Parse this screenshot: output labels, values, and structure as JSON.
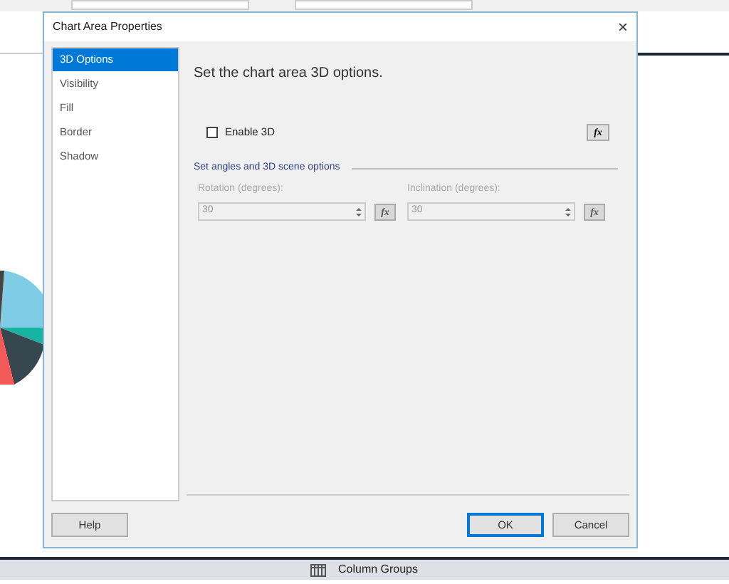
{
  "background": {
    "bottom_bar": {
      "label": "Column Groups"
    }
  },
  "dialog": {
    "title": "Chart Area Properties",
    "close": "×",
    "nav": [
      {
        "label": "3D Options",
        "selected": true
      },
      {
        "label": "Visibility",
        "selected": false
      },
      {
        "label": "Fill",
        "selected": false
      },
      {
        "label": "Border",
        "selected": false
      },
      {
        "label": "Shadow",
        "selected": false
      }
    ],
    "heading": "Set the chart area 3D options.",
    "enable_3d": {
      "label": "Enable 3D",
      "checked": false,
      "expression": "fx"
    },
    "section": "Set angles and 3D scene options",
    "fields": [
      {
        "label": "Rotation (degrees):",
        "value": "30",
        "disabled": true,
        "expression": "fx"
      },
      {
        "label": "Inclination (degrees):",
        "value": "30",
        "disabled": true,
        "expression": "fx"
      }
    ],
    "buttons": [
      {
        "label": "Help",
        "kind": "help"
      },
      {
        "label": "OK",
        "kind": "default"
      },
      {
        "label": "Cancel",
        "kind": "normal"
      }
    ]
  }
}
